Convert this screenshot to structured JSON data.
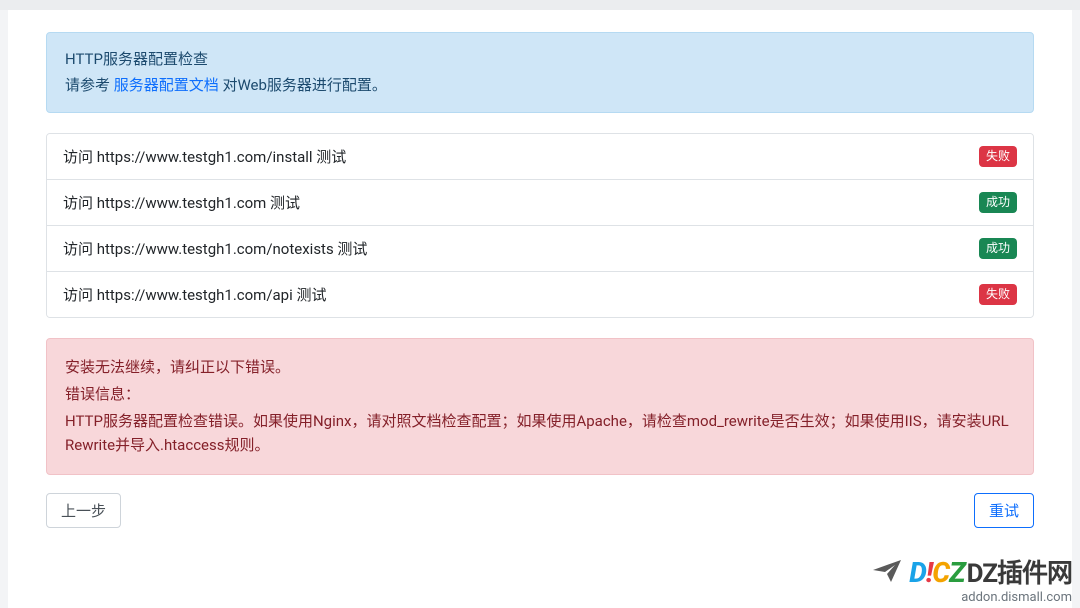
{
  "info_alert": {
    "title": "HTTP服务器配置检查",
    "prefix": "请参考 ",
    "link_text": "服务器配置文档",
    "suffix": " 对Web服务器进行配置。"
  },
  "checks": [
    {
      "label": "访问 https://www.testgh1.com/install 测试",
      "status": "fail",
      "badge": "失败"
    },
    {
      "label": "访问 https://www.testgh1.com 测试",
      "status": "success",
      "badge": "成功"
    },
    {
      "label": "访问 https://www.testgh1.com/notexists 测试",
      "status": "success",
      "badge": "成功"
    },
    {
      "label": "访问 https://www.testgh1.com/api 测试",
      "status": "fail",
      "badge": "失败"
    }
  ],
  "error_alert": {
    "line1": "安装无法继续，请纠正以下错误。",
    "line2": "错误信息：",
    "line3": "HTTP服务器配置检查错误。如果使用Nginx，请对照文档检查配置；如果使用Apache，请检查mod_rewrite是否生效；如果使用IIS，请安装URL Rewrite并导入.htaccess规则。"
  },
  "buttons": {
    "prev": "上一步",
    "retry": "重试"
  },
  "watermark": {
    "brand_parts": {
      "d": "D",
      "i": "!",
      "c": "C",
      "z": "Z"
    },
    "overlay": "DZ插件网",
    "sub": "addon.dismall.com"
  }
}
